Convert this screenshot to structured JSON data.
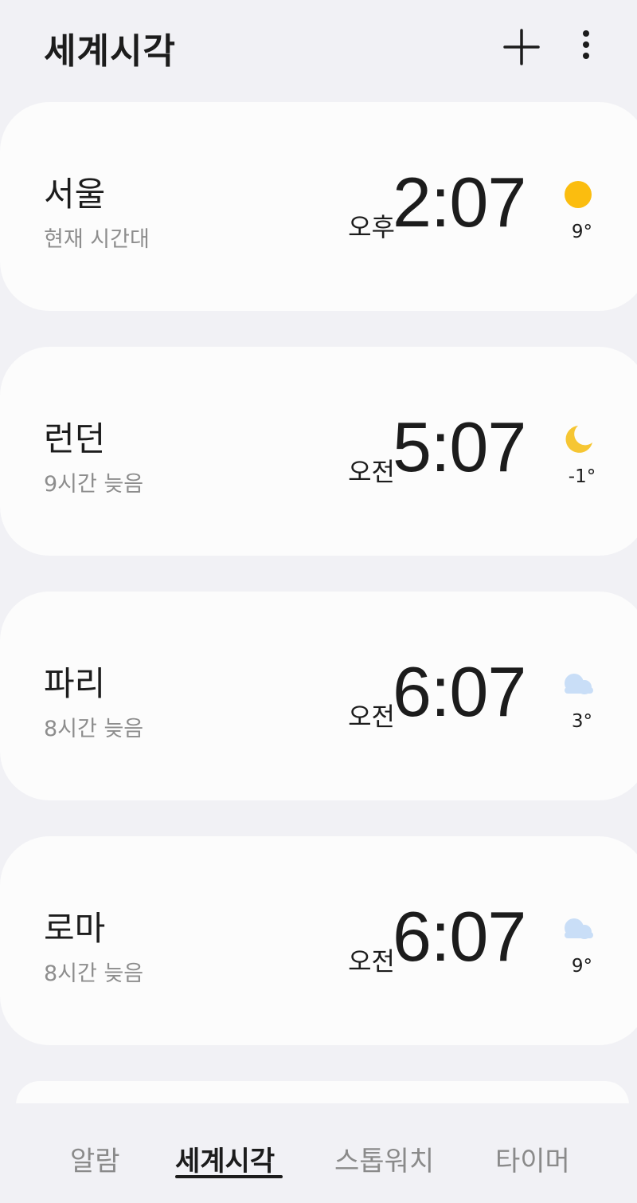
{
  "header": {
    "title": "세계시각",
    "add_icon": "plus-icon",
    "more_icon": "more-vertical-icon"
  },
  "clocks": [
    {
      "city": "서울",
      "subtitle": "현재 시간대",
      "ampm": "오후",
      "time": "2:07",
      "weather": "sun-icon",
      "temp": "9°"
    },
    {
      "city": "런던",
      "subtitle": "9시간 늦음",
      "ampm": "오전",
      "time": "5:07",
      "weather": "moon-icon",
      "temp": "-1°"
    },
    {
      "city": "파리",
      "subtitle": "8시간 늦음",
      "ampm": "오전",
      "time": "6:07",
      "weather": "cloud-icon",
      "temp": "3°"
    },
    {
      "city": "로마",
      "subtitle": "8시간 늦음",
      "ampm": "오전",
      "time": "6:07",
      "weather": "cloud-icon",
      "temp": "9°"
    }
  ],
  "bottom_nav": {
    "tabs": [
      {
        "label": "알람"
      },
      {
        "label": "세계시각",
        "active": true
      },
      {
        "label": "스톱워치"
      },
      {
        "label": "타이머"
      }
    ]
  },
  "colors": {
    "sun": "#fbbd0f",
    "moon": "#f6c633",
    "cloud": "#c9def7",
    "background": "#f1f1f5",
    "card": "#fcfcfc"
  }
}
